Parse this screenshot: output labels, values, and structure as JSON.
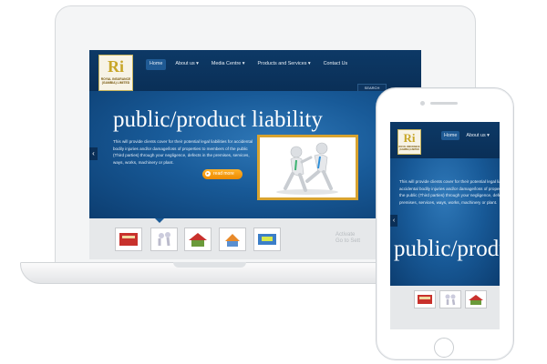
{
  "brand": {
    "logo_letters": "Ri",
    "logo_sub": "ROYAL INSURANCE (GAMBIA) LIMITED"
  },
  "nav": {
    "items": [
      "Home",
      "About us ▾",
      "Media Centre ▾",
      "Products and Services ▾",
      "Contact Us"
    ],
    "active": "Home"
  },
  "search": {
    "label": "SEARCH"
  },
  "hero": {
    "title": "public/product liability",
    "body": "This will provide clients cover for their potential legal liabilities for accidental bodily injuries and/or damage/loss of properties to members of the public (Third parties) through your negligence, defects in the premises, services, ways, works, machinery or plant.",
    "read_more": "read more",
    "prev_arrow": "‹",
    "next_arrow": "›"
  },
  "thumbnails": {
    "count": 5,
    "active_index": 1,
    "icons": [
      "motor-insurance-thumb-icon",
      "liability-thumb-icon",
      "house-thumb-icon",
      "property-thumb-icon",
      "travel-thumb-icon"
    ]
  },
  "watermark": {
    "line1": "Activate",
    "line2": "Go to Sett"
  },
  "phone": {
    "nav_items": [
      "Home",
      "About us ▾"
    ],
    "active": "Home",
    "body": "This will provide clients cover for their potential legal liabilities for accidental bodily injuries and/or damage/loss of properties to members of the public (Third parties) through your negligence, defects in the premises, services, ways, works, machinery or plant.",
    "title": "public/product",
    "prev_arrow": "‹"
  },
  "colors": {
    "nav_bg": "#0a2f57",
    "hero_blue": "#185a98",
    "accent_orange": "#ec8a00",
    "frame_gold": "#d8a330"
  }
}
